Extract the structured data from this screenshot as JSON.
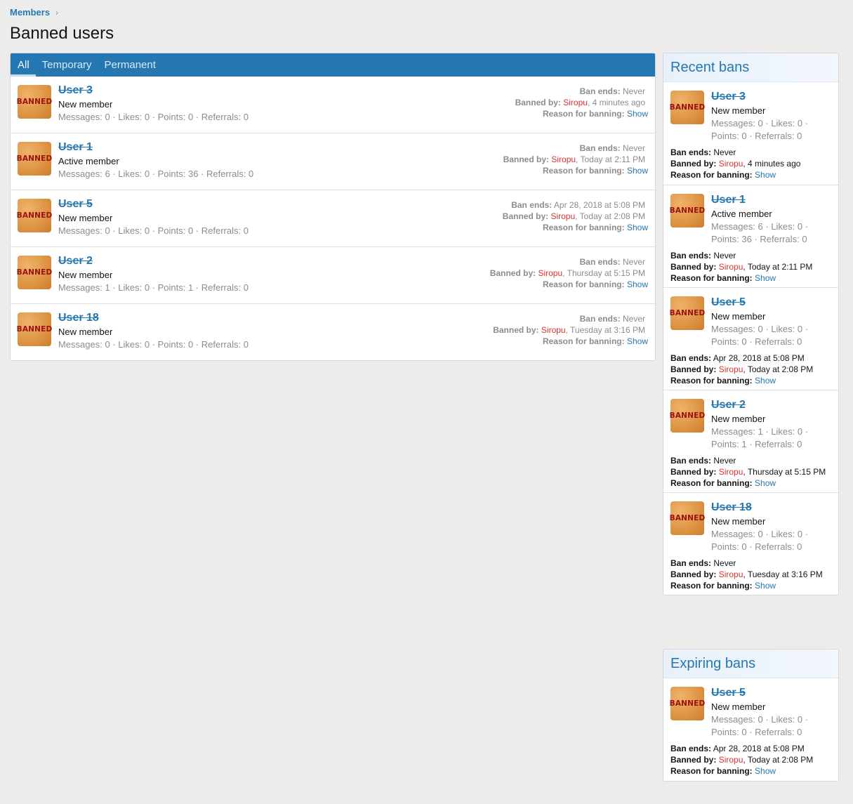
{
  "breadcrumb": {
    "items": [
      "Members"
    ],
    "separator": "›"
  },
  "page_title": "Banned users",
  "tabs": [
    {
      "label": "All",
      "active": true
    },
    {
      "label": "Temporary",
      "active": false
    },
    {
      "label": "Permanent",
      "active": false
    }
  ],
  "labels": {
    "ban_ends": "Ban ends:",
    "banned_by": "Banned by:",
    "reason": "Reason for banning:",
    "show": "Show",
    "avatar_text": "BANNED"
  },
  "colors": {
    "accent": "#2577b1",
    "banner": "#e03030",
    "background": "#ececec"
  },
  "main_list": [
    {
      "name": "User 3",
      "title": "New member",
      "stats": "Messages: 0 · Likes: 0 · Points: 0 · Referrals: 0",
      "ban_ends": "Never",
      "banned_by": "Siropu",
      "banned_when": ", 4 minutes ago"
    },
    {
      "name": "User 1",
      "title": "Active member",
      "stats": "Messages: 6 · Likes: 0 · Points: 36 · Referrals: 0",
      "ban_ends": "Never",
      "banned_by": "Siropu",
      "banned_when": ", Today at 2:11 PM"
    },
    {
      "name": "User 5",
      "title": "New member",
      "stats": "Messages: 0 · Likes: 0 · Points: 0 · Referrals: 0",
      "ban_ends": "Apr 28, 2018 at 5:08 PM",
      "banned_by": "Siropu",
      "banned_when": ", Today at 2:08 PM"
    },
    {
      "name": "User 2",
      "title": "New member",
      "stats": "Messages: 1 · Likes: 0 · Points: 1 · Referrals: 0",
      "ban_ends": "Never",
      "banned_by": "Siropu",
      "banned_when": ", Thursday at 5:15 PM"
    },
    {
      "name": "User 18",
      "title": "New member",
      "stats": "Messages: 0 · Likes: 0 · Points: 0 · Referrals: 0",
      "ban_ends": "Never",
      "banned_by": "Siropu",
      "banned_when": ", Tuesday at 3:16 PM"
    }
  ],
  "recent_bans": {
    "title": "Recent bans",
    "items": [
      {
        "name": "User 3",
        "title": "New member",
        "stats1": "Messages: 0 · Likes: 0 ·",
        "stats2": "Points: 0 · Referrals: 0",
        "ban_ends": "Never",
        "banned_by": "Siropu",
        "banned_when": ", 4 minutes ago"
      },
      {
        "name": "User 1",
        "title": "Active member",
        "stats1": "Messages: 6 · Likes: 0 ·",
        "stats2": "Points: 36 · Referrals: 0",
        "ban_ends": "Never",
        "banned_by": "Siropu",
        "banned_when": ", Today at 2:11 PM"
      },
      {
        "name": "User 5",
        "title": "New member",
        "stats1": "Messages: 0 · Likes: 0 ·",
        "stats2": "Points: 0 · Referrals: 0",
        "ban_ends": "Apr 28, 2018 at 5:08 PM",
        "banned_by": "Siropu",
        "banned_when": ", Today at 2:08 PM"
      },
      {
        "name": "User 2",
        "title": "New member",
        "stats1": "Messages: 1 · Likes: 0 ·",
        "stats2": "Points: 1 · Referrals: 0",
        "ban_ends": "Never",
        "banned_by": "Siropu",
        "banned_when": ", Thursday at 5:15 PM"
      },
      {
        "name": "User 18",
        "title": "New member",
        "stats1": "Messages: 0 · Likes: 0 ·",
        "stats2": "Points: 0 · Referrals: 0",
        "ban_ends": "Never",
        "banned_by": "Siropu",
        "banned_when": ", Tuesday at 3:16 PM"
      }
    ]
  },
  "expiring_bans": {
    "title": "Expiring bans",
    "items": [
      {
        "name": "User 5",
        "title": "New member",
        "stats1": "Messages: 0 · Likes: 0 ·",
        "stats2": "Points: 0 · Referrals: 0",
        "ban_ends": "Apr 28, 2018 at 5:08 PM",
        "banned_by": "Siropu",
        "banned_when": ", Today at 2:08 PM"
      }
    ]
  }
}
